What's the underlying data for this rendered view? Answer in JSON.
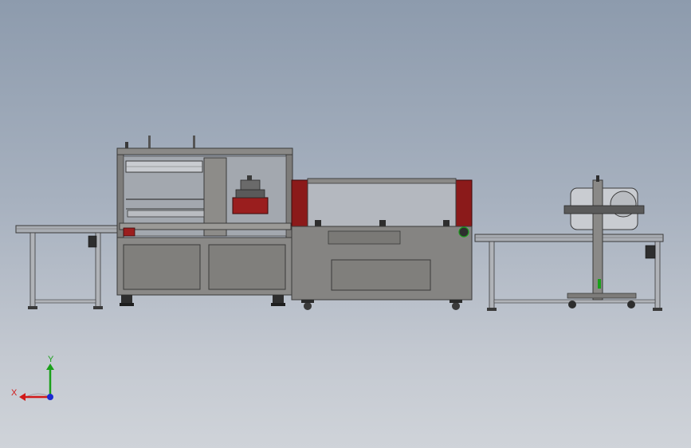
{
  "view": {
    "background_top": "#8d9bad",
    "background_bottom": "#cfd3d9"
  },
  "colors": {
    "frame": "#7d7c7a",
    "frame_dark": "#4a4a4a",
    "panel": "#8a8987",
    "accent_red": "#8b1a1a",
    "glass": "#b4b8bf",
    "conveyor": "#a9adb3"
  },
  "triad": {
    "x_label": "X",
    "y_label": "Y",
    "x_color": "#d11a1a",
    "y_color": "#1aa01a",
    "z_color": "#1a2ad1"
  },
  "components": {
    "left_conveyor": "left-infeed-conveyor",
    "sealer": "l-bar-sealer-machine",
    "shrink_tunnel": "heat-shrink-tunnel",
    "right_conveyor": "right-outfeed-conveyor",
    "labeler": "film-roll-labeler-stand"
  }
}
